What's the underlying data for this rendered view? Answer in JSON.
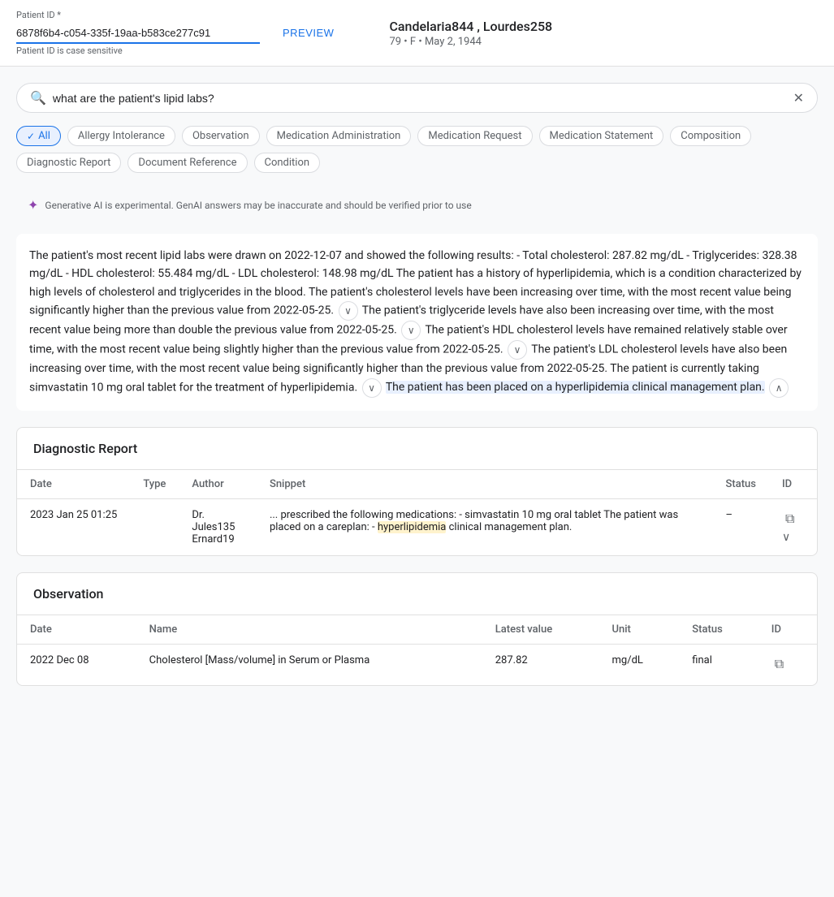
{
  "header": {
    "patient_id_label": "Patient ID *",
    "patient_id_value": "6878f6b4-c054-335f-19aa-b583ce277c91",
    "patient_id_hint": "Patient ID is case sensitive",
    "preview_button": "PREVIEW",
    "patient_name": "Candelaria844 , Lourdes258",
    "patient_details": "79 • F • May 2, 1944"
  },
  "search": {
    "placeholder": "what are the patient's lipid labs?",
    "value": "what are the patient's lipid labs?"
  },
  "filters": [
    {
      "id": "all",
      "label": "All",
      "active": true
    },
    {
      "id": "allergy",
      "label": "Allergy Intolerance",
      "active": false
    },
    {
      "id": "observation",
      "label": "Observation",
      "active": false
    },
    {
      "id": "medication_admin",
      "label": "Medication Administration",
      "active": false
    },
    {
      "id": "medication_request",
      "label": "Medication Request",
      "active": false
    },
    {
      "id": "medication_statement",
      "label": "Medication Statement",
      "active": false
    },
    {
      "id": "composition",
      "label": "Composition",
      "active": false
    },
    {
      "id": "diagnostic_report",
      "label": "Diagnostic Report",
      "active": false
    },
    {
      "id": "document_reference",
      "label": "Document Reference",
      "active": false
    },
    {
      "id": "condition",
      "label": "Condition",
      "active": false
    }
  ],
  "ai_notice": "Generative AI is experimental. GenAI answers may be inaccurate and should be verified prior to use",
  "answer": {
    "text_before_expand1": "The patient's most recent lipid labs were drawn on 2022-12-07 and showed the following results: - Total cholesterol: 287.82 mg/dL - Triglycerides: 328.38 mg/dL - HDL cholesterol: 55.484 mg/dL - LDL cholesterol: 148.98 mg/dL The patient has a history of hyperlipidemia, which is a condition characterized by high levels of cholesterol and triglycerides in the blood. The patient's cholesterol levels have been increasing over time, with the most recent value being significantly higher than the previous value from 2022-05-25.",
    "text_triglycerides": "The patient's triglyceride levels have also been increasing over time, with the most recent value being more than double the previous value from 2022-05-25.",
    "text_hdl": "The patient's HDL cholesterol levels have remained relatively stable over time, with the most recent value being slightly higher than the previous value from 2022-05-25.",
    "text_ldl": "The patient's LDL cholesterol levels have also been increasing over time, with the most recent value being significantly higher than the previous value from 2022-05-25. The patient is currently taking simvastatin 10 mg oral tablet for the treatment of hyperlipidemia.",
    "text_highlighted": "The patient has been placed on a hyperlipidemia clinical management plan."
  },
  "diagnostic_report": {
    "section_title": "Diagnostic Report",
    "columns": [
      "Date",
      "Type",
      "Author",
      "Snippet",
      "Status",
      "ID"
    ],
    "rows": [
      {
        "date": "2023  Jan  25  01:25",
        "type": "",
        "author_line1": "Dr. Jules135",
        "author_line2": "Ernard19",
        "snippet_before": "... prescribed the following medications: - simvastatin 10 mg oral tablet The patient was placed on a careplan: -",
        "snippet_highlight": "hyperlipidemia",
        "snippet_after": "clinical management plan.",
        "status": "–",
        "id": "copy"
      }
    ]
  },
  "observation": {
    "section_title": "Observation",
    "columns": [
      "Date",
      "Name",
      "Latest value",
      "Unit",
      "Status",
      "ID"
    ],
    "rows": [
      {
        "date": "2022  Dec  08",
        "name": "Cholesterol [Mass/volume] in Serum or Plasma",
        "latest_value": "287.82",
        "unit": "mg/dL",
        "status": "final",
        "id": "copy"
      }
    ]
  }
}
